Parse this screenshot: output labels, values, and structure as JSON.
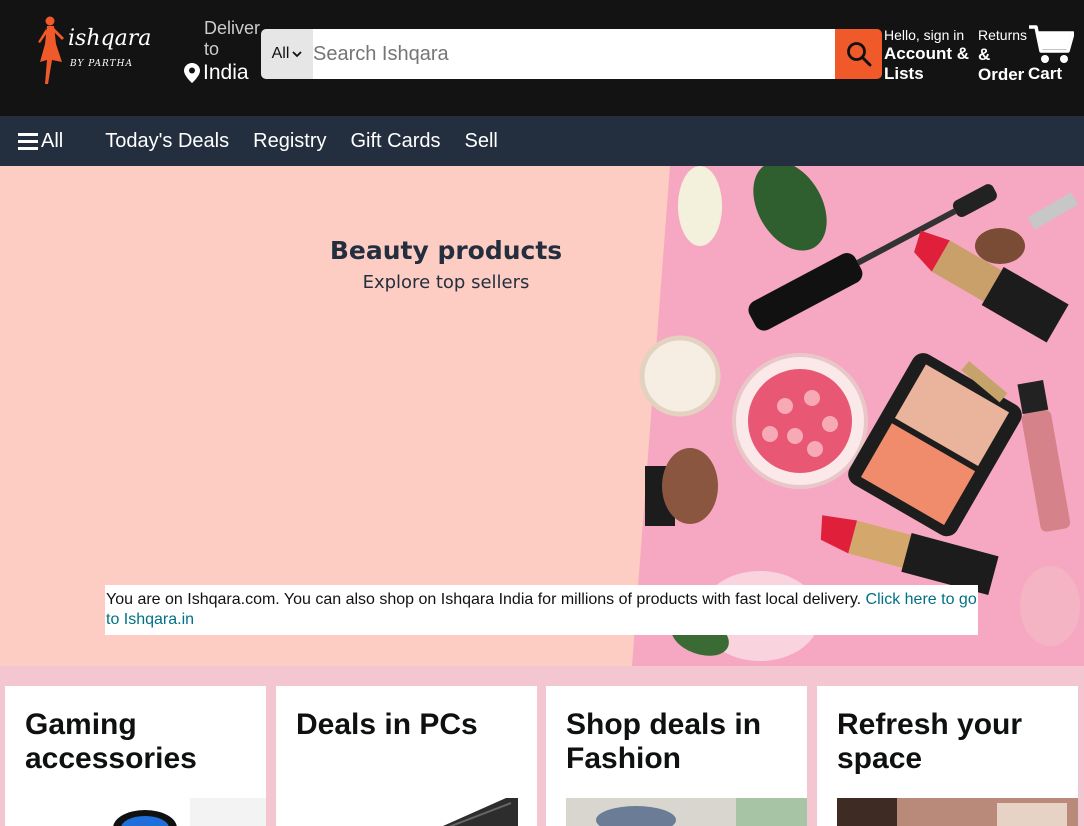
{
  "header": {
    "logo": {
      "word": "ishqara",
      "byline": "BY PARTHA"
    },
    "deliver": {
      "line1": "Deliver",
      "line2": "to",
      "country": "India"
    },
    "search": {
      "category": "All",
      "placeholder": "Search Ishqara"
    },
    "account": {
      "hello": "Hello, sign in",
      "lists": "Account & Lists"
    },
    "returns": {
      "line1": "Returns",
      "line2": "& Order"
    },
    "cart": {
      "label": "Cart"
    }
  },
  "nav": {
    "all": "All",
    "items": [
      "Today's Deals",
      "Registry",
      "Gift Cards",
      "Sell"
    ]
  },
  "hero": {
    "title": "Beauty products",
    "subtitle": "Explore top sellers"
  },
  "notice": {
    "text": "You are on Ishqara.com. You can also shop on Ishqara India for millions of products with fast local delivery. ",
    "link": "Click here to go to Ishqara.in"
  },
  "cards": [
    {
      "title": "Gaming accessories"
    },
    {
      "title": "Deals in PCs"
    },
    {
      "title": "Shop deals in Fashion"
    },
    {
      "title": "Refresh your space"
    }
  ],
  "colors": {
    "header_bg": "#131313",
    "nav_bg": "#232f3e",
    "search_button": "#f0592a",
    "hero_bg": "#fdccc3",
    "page_bg": "#f4c6d2",
    "link": "#007185"
  }
}
